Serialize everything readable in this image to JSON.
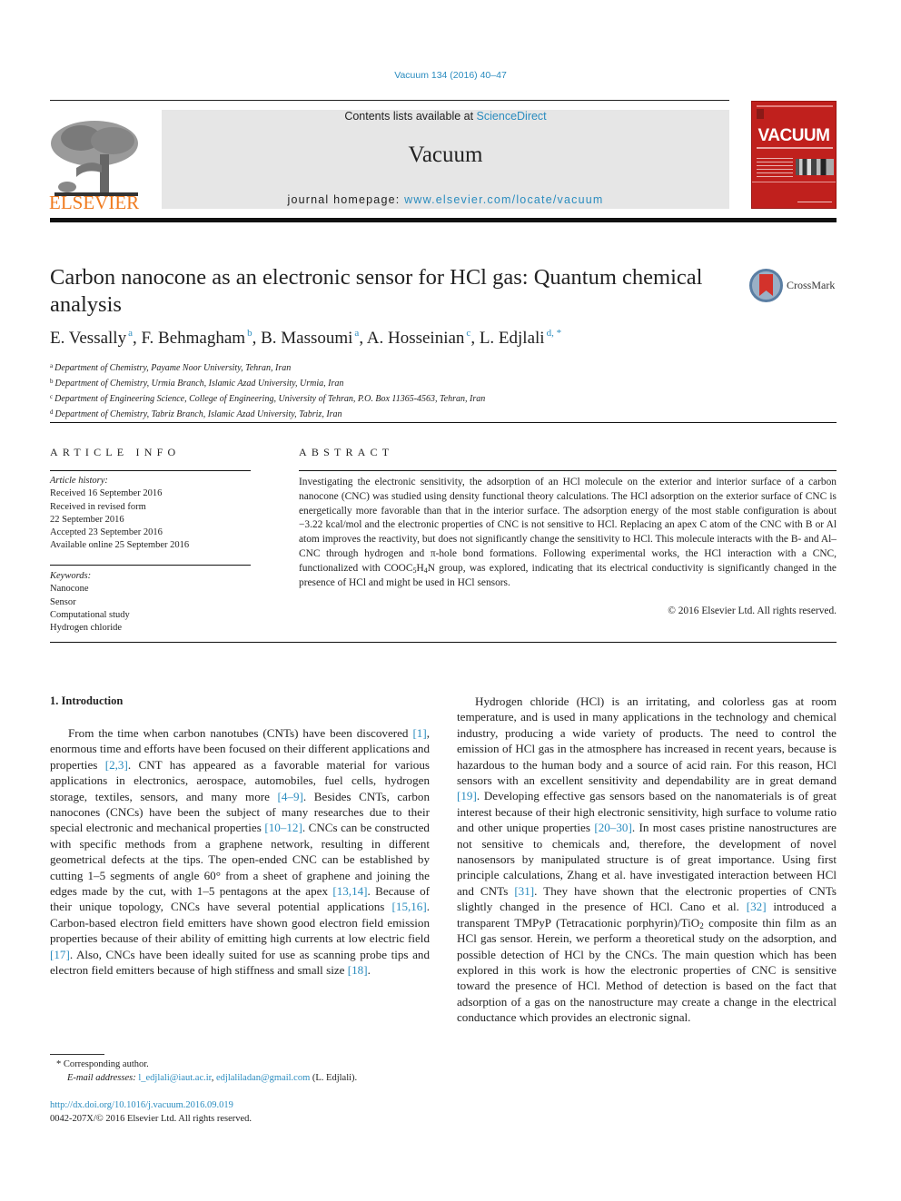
{
  "header": {
    "citation": "Vacuum 134 (2016) 40–47",
    "contents_prefix": "Contents lists available at ",
    "contents_link": "ScienceDirect",
    "journal_title": "Vacuum",
    "homepage_prefix": "journal homepage: ",
    "homepage_link": "www.elsevier.com/locate/vacuum",
    "publisher_logo": "ELSEVIER",
    "cover_title": "VACUUM",
    "crossmark_label": "CrossMark"
  },
  "article": {
    "title": "Carbon nanocone as an electronic sensor for HCl gas: Quantum chemical analysis",
    "authors": [
      {
        "name": "E. Vessally",
        "sup": "a"
      },
      {
        "name": "F. Behmagham",
        "sup": "b"
      },
      {
        "name": "B. Massoumi",
        "sup": "a"
      },
      {
        "name": "A. Hosseinian",
        "sup": "c"
      },
      {
        "name": "L. Edjlali",
        "sup": "d, *"
      }
    ],
    "affiliations": [
      {
        "key": "a",
        "text": "Department of Chemistry, Payame Noor University, Tehran, Iran"
      },
      {
        "key": "b",
        "text": "Department of Chemistry, Urmia Branch, Islamic Azad University, Urmia, Iran"
      },
      {
        "key": "c",
        "text": "Department of Engineering Science, College of Engineering, University of Tehran, P.O. Box 11365-4563, Tehran, Iran"
      },
      {
        "key": "d",
        "text": "Department of Chemistry, Tabriz Branch, Islamic Azad University, Tabriz, Iran"
      }
    ]
  },
  "article_info": {
    "heading": "ARTICLE INFO",
    "history_label": "Article history:",
    "history": [
      "Received 16 September 2016",
      "Received in revised form",
      "22 September 2016",
      "Accepted 23 September 2016",
      "Available online 25 September 2016"
    ],
    "keywords_label": "Keywords:",
    "keywords": [
      "Nanocone",
      "Sensor",
      "Computational study",
      "Hydrogen chloride"
    ]
  },
  "abstract": {
    "heading": "ABSTRACT",
    "text_1": "Investigating the electronic sensitivity, the adsorption of an HCl molecule on the exterior and interior surface of a carbon nanocone (CNC) was studied using density functional theory calculations. The HCl adsorption on the exterior surface of CNC is energetically more favorable than that in the interior surface. The adsorption energy of the most stable configuration is about −3.22 kcal/mol and the electronic properties of CNC is not sensitive to HCl. Replacing an apex C atom of the CNC with B or Al atom improves the reactivity, but does not significantly change the sensitivity to HCl. This molecule interacts with the B- and Al–CNC through hydrogen and π-hole bond formations. Following experimental works, the HCl interaction with a CNC, functionalized with COOC",
    "sub_1": "5",
    "text_2": "H",
    "sub_2": "4",
    "text_3": "N group, was explored, indicating that its electrical conductivity is significantly changed in the presence of HCl and might be used in HCl sensors.",
    "copyright": "© 2016 Elsevier Ltd. All rights reserved."
  },
  "introduction": {
    "heading": "1.  Introduction",
    "left": [
      {
        "t": "From the time when carbon nanotubes (CNTs) have been discovered "
      },
      {
        "ref": "[1]"
      },
      {
        "t": ", enormous time and efforts have been focused on their different applications and properties "
      },
      {
        "ref": "[2,3]"
      },
      {
        "t": ". CNT has appeared as a favorable material for various applications in electronics, aerospace, automobiles, fuel cells, hydrogen storage, textiles, sensors, and many more "
      },
      {
        "ref": "[4–9]"
      },
      {
        "t": ". Besides CNTs, carbon nanocones (CNCs) have been the subject of many researches due to their special electronic and mechanical properties "
      },
      {
        "ref": "[10–12]"
      },
      {
        "t": ". CNCs can be constructed with specific methods from a graphene network, resulting in different geometrical defects at the tips. The open-ended CNC can be established by cutting 1–5 segments of angle 60° from a sheet of graphene and joining the edges made by the cut, with 1–5 pentagons at the apex "
      },
      {
        "ref": "[13,14]"
      },
      {
        "t": ". Because of their unique topology, CNCs have several potential applications "
      },
      {
        "ref": "[15,16]"
      },
      {
        "t": ". Carbon-based electron field emitters have shown good electron field emission properties because of their ability of emitting high currents at low electric field "
      },
      {
        "ref": "[17]"
      },
      {
        "t": ". Also, CNCs have been ideally suited for use as scanning probe tips and electron field emitters because of high stiffness and small size "
      },
      {
        "ref": "[18]"
      },
      {
        "t": "."
      }
    ],
    "right": [
      {
        "t": "Hydrogen chloride (HCl) is an irritating, and colorless gas at room temperature, and is used in many applications in the technology and chemical industry, producing a wide variety of products. The need to control the emission of HCl gas in the atmosphere has increased in recent years, because is hazardous to the human body and a source of acid rain. For this reason, HCl sensors with an excellent sensitivity and dependability are in great demand "
      },
      {
        "ref": "[19]"
      },
      {
        "t": ". Developing effective gas sensors based on the nanomaterials is of great interest because of their high electronic sensitivity, high surface to volume ratio and other unique properties "
      },
      {
        "ref": "[20–30]"
      },
      {
        "t": ". In most cases pristine nanostructures are not sensitive to chemicals and, therefore, the development of novel nanosensors by manipulated structure is of great importance. Using first principle calculations, Zhang et al. have investigated interaction between HCl and CNTs "
      },
      {
        "ref": "[31]"
      },
      {
        "t": ". They have shown that the electronic properties of CNTs slightly changed in the presence of HCl. Cano et al. "
      },
      {
        "ref": "[32]"
      },
      {
        "t": " introduced a transparent TMPyP (Tetracationic porphyrin)/TiO"
      },
      {
        "sub": "2"
      },
      {
        "t": " composite thin film as an HCl gas sensor. Herein, we perform a theoretical study on the adsorption, and possible detection of HCl by the CNCs. The main question which has been explored in this work is how the electronic properties of CNC is sensitive toward the presence of HCl. Method of detection is based on the fact that adsorption of a gas on the nanostructure may create a change in the electrical conductance which provides an electronic signal."
      }
    ]
  },
  "footnote": {
    "corresponding": "* Corresponding author.",
    "email_label": "E-mail addresses: ",
    "emails": [
      "l_edjlali@iaut.ac.ir",
      "edjlaliladan@gmail.com"
    ],
    "email_suffix": " (L. Edjlali).",
    "doi": "http://dx.doi.org/10.1016/j.vacuum.2016.09.019",
    "issn": "0042-207X/© 2016 Elsevier Ltd. All rights reserved."
  },
  "colors": {
    "link": "#2a8cbf",
    "elsevier_orange": "#f07b1f",
    "cover_red": "#c0201d",
    "masthead_gray": "#e6e6e6"
  }
}
